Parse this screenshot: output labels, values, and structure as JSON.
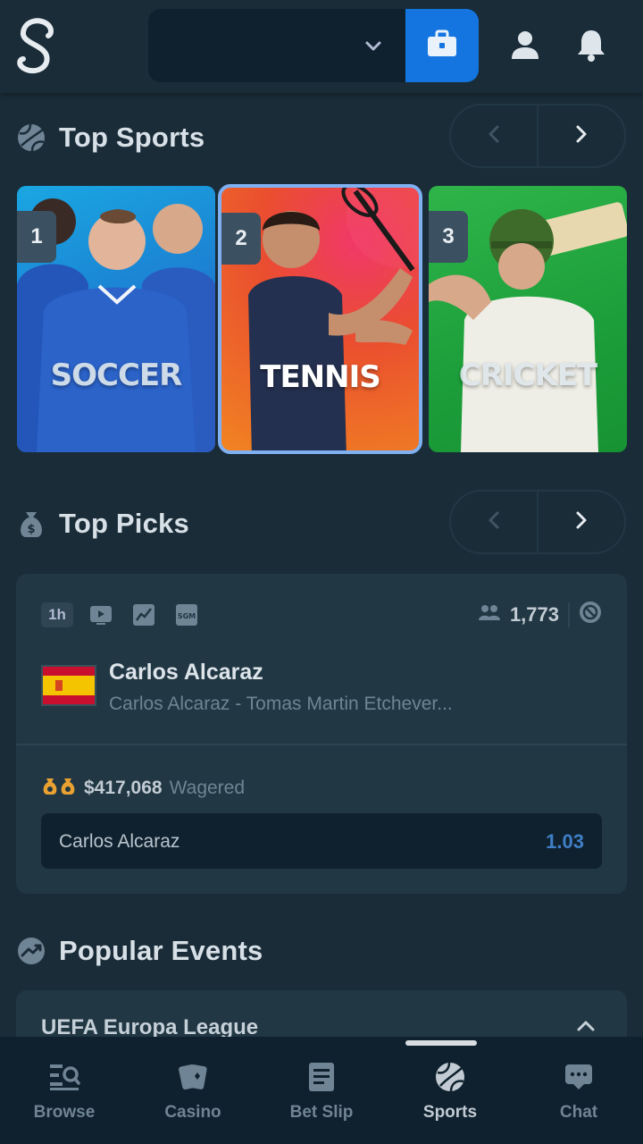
{
  "header": {
    "logo_letter": "S",
    "wallet_balance": "",
    "icons": {
      "wallet": "wallet-icon",
      "user": "user-icon",
      "notifications": "bell-icon",
      "dropdown": "chevron-down-icon"
    }
  },
  "top_sports": {
    "title": "Top Sports",
    "cards": [
      {
        "rank": "1",
        "label": "SOCCER",
        "color": "#1c79cf"
      },
      {
        "rank": "2",
        "label": "TENNIS",
        "color": "#ea4e2f",
        "selected": true
      },
      {
        "rank": "3",
        "label": "CRICKET",
        "color": "#1c9e3a"
      }
    ]
  },
  "top_picks": {
    "title": "Top Picks",
    "card": {
      "time_badge": "1h",
      "bettors": "1,773",
      "player": "Carlos Alcaraz",
      "match": "Carlos Alcaraz - Tomas Martin Etchever...",
      "wagered_amount": "$417,068",
      "wagered_label": "Wagered",
      "outcome_name": "Carlos Alcaraz",
      "outcome_odds": "1.03",
      "flag": "spain-flag"
    }
  },
  "popular_events": {
    "title": "Popular Events",
    "first_league": "UEFA Europa League"
  },
  "bottom_nav": {
    "items": [
      {
        "label": "Browse",
        "icon": "browse-icon"
      },
      {
        "label": "Casino",
        "icon": "casino-icon"
      },
      {
        "label": "Bet Slip",
        "icon": "bet-slip-icon"
      },
      {
        "label": "Sports",
        "icon": "sports-icon",
        "active": true
      },
      {
        "label": "Chat",
        "icon": "chat-icon"
      }
    ]
  },
  "colors": {
    "background": "#1a2c38",
    "card": "#213743",
    "dark": "#0f212e",
    "accent": "#1475e1",
    "odds": "#3f7fc7"
  }
}
